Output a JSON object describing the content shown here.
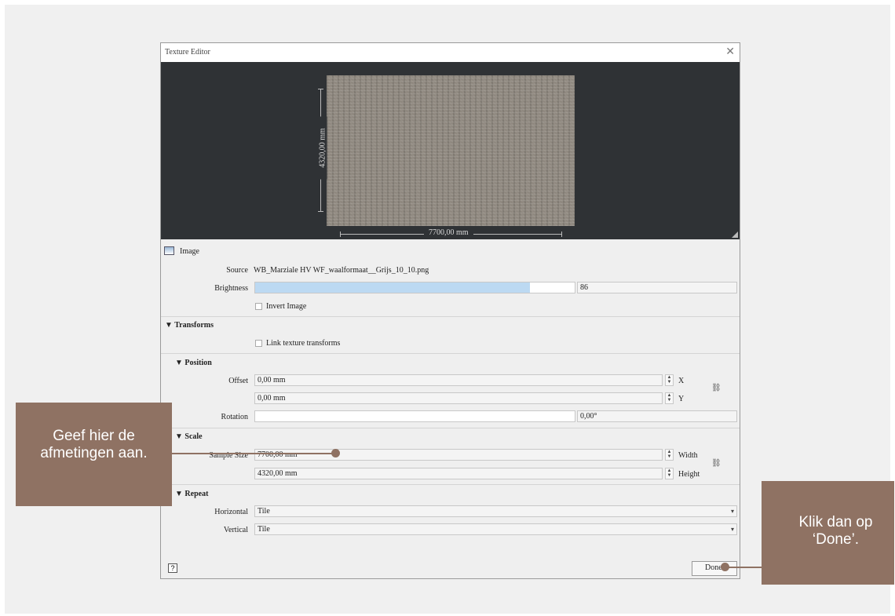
{
  "window": {
    "title": "Texture Editor"
  },
  "preview": {
    "height_label": "4320,00 mm",
    "width_label": "7700,00 mm"
  },
  "image_section": {
    "header": "Image",
    "source_label": "Source",
    "source_value": "WB_Marziale HV WF_waalformaat__Grijs_10_10.png",
    "brightness_label": "Brightness",
    "brightness_value": "86",
    "brightness_fraction": 0.86,
    "invert_label": "Invert Image"
  },
  "transforms": {
    "header": "Transforms",
    "link_label": "Link texture transforms",
    "position": {
      "header": "Position",
      "offset_label": "Offset",
      "x_value": "0,00 mm",
      "x_axis": "X",
      "y_value": "0,00 mm",
      "y_axis": "Y",
      "rotation_label": "Rotation",
      "rotation_value": "0,00°"
    },
    "scale": {
      "header": "Scale",
      "sample_label": "Sample Size",
      "width_value": "7700,00 mm",
      "width_label": "Width",
      "height_value": "4320,00 mm",
      "height_label": "Height"
    },
    "repeat": {
      "header": "Repeat",
      "horizontal_label": "Horizontal",
      "horizontal_value": "Tile",
      "vertical_label": "Vertical",
      "vertical_value": "Tile"
    }
  },
  "footer": {
    "help": "?",
    "done_label": "Done"
  },
  "callouts": {
    "left": "Geef hier de afmetingen aan.",
    "right": "Klik dan op ‘Done’."
  },
  "colors": {
    "callout": "#8f7263",
    "brightness_fill": "#bcd9f2",
    "preview_bg": "#2f3235"
  }
}
